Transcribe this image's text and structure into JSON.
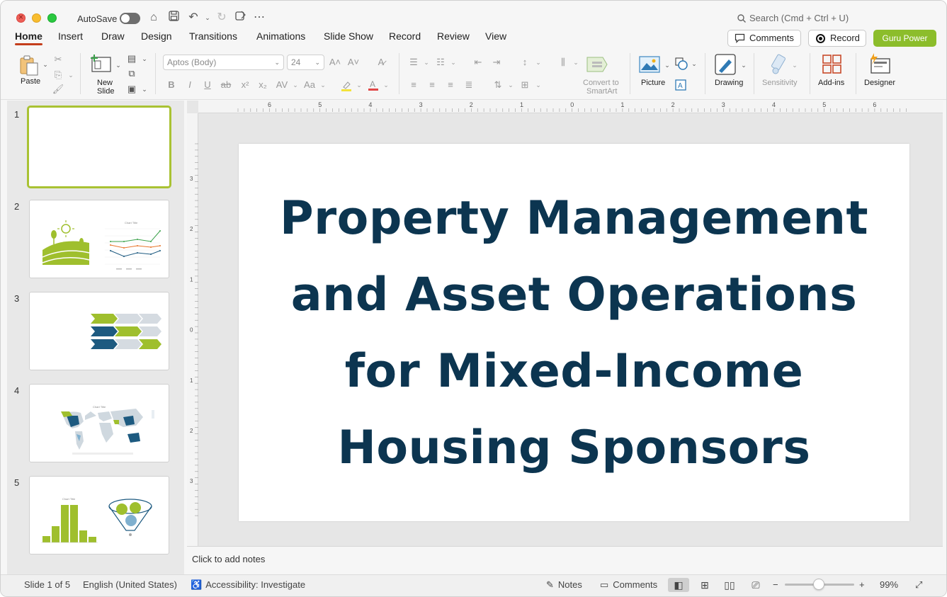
{
  "titlebar": {
    "autosave_label": "AutoSave",
    "search_placeholder": "Search (Cmd + Ctrl + U)"
  },
  "tabs": [
    "Home",
    "Insert",
    "Draw",
    "Design",
    "Transitions",
    "Animations",
    "Slide Show",
    "Record",
    "Review",
    "View"
  ],
  "actions": {
    "comments": "Comments",
    "record": "Record",
    "guru": "Guru Power"
  },
  "ribbon": {
    "paste": "Paste",
    "new_slide_1": "New",
    "new_slide_2": "Slide",
    "font_name": "Aptos (Body)",
    "font_size": "24",
    "convert_1": "Convert to",
    "convert_2": "SmartArt",
    "picture": "Picture",
    "drawing": "Drawing",
    "sensitivity": "Sensitivity",
    "addins": "Add-ins",
    "designer": "Designer"
  },
  "slides": [
    "1",
    "2",
    "3",
    "4",
    "5"
  ],
  "slide": {
    "title_lines": [
      "Property Management",
      "and Asset Operations",
      "for Mixed-Income",
      "Housing Sponsors"
    ]
  },
  "notes_placeholder": "Click to add notes",
  "status": {
    "slide_of": "Slide 1 of 5",
    "language": "English (United States)",
    "accessibility": "Accessibility: Investigate",
    "notes": "Notes",
    "comments": "Comments",
    "zoom_level": "99%"
  },
  "ruler": {
    "top_ticks": [
      "6",
      "5",
      "4",
      "3",
      "2",
      "1",
      "0",
      "1",
      "2",
      "3",
      "4",
      "5",
      "6"
    ],
    "left_ticks": [
      "3",
      "2",
      "1",
      "0",
      "1",
      "2",
      "3"
    ]
  },
  "colors": {
    "accent": "#c43e1c",
    "guru": "#8cbd2b",
    "title": "#0c3550",
    "thumb_green": "#a9c233",
    "thumb_blue": "#1d5a80"
  }
}
